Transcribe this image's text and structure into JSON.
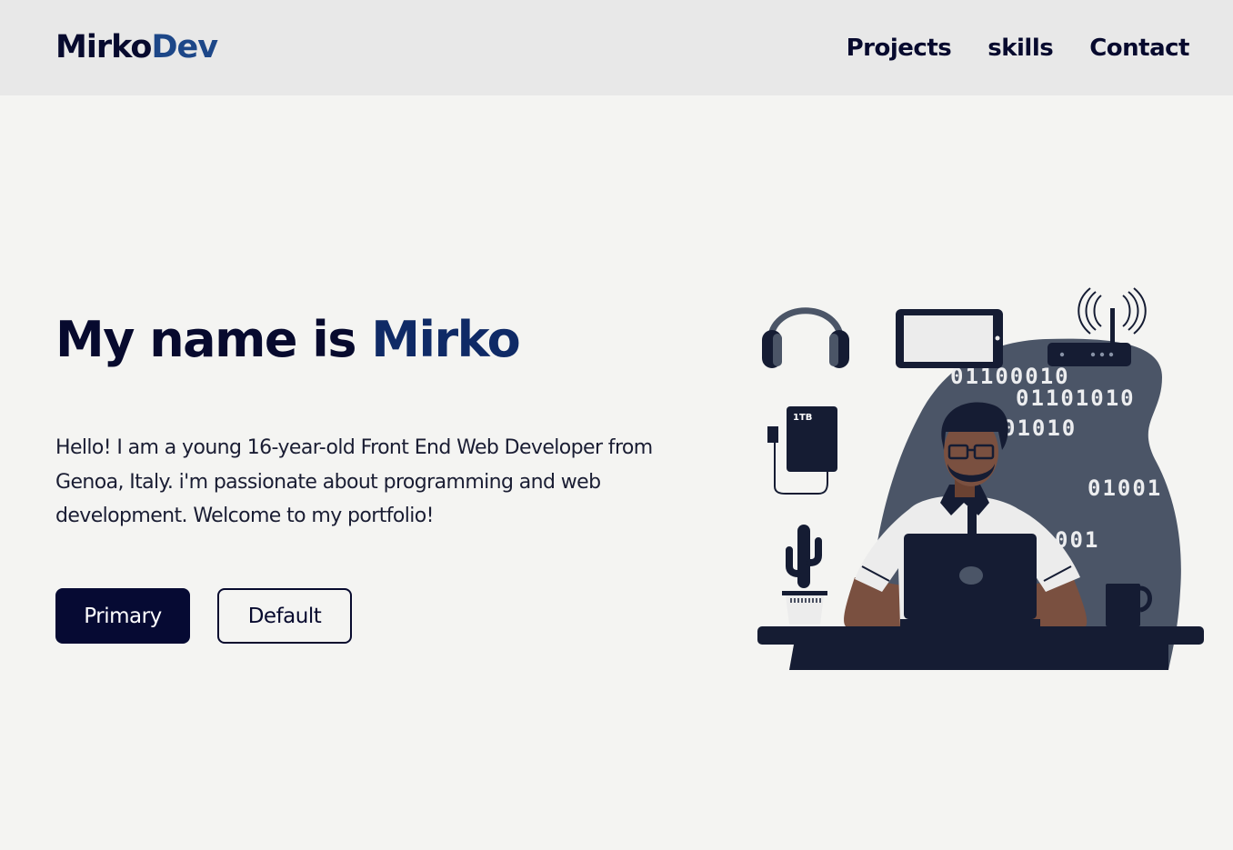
{
  "header": {
    "logo_primary": "Mirko",
    "logo_accent": "Dev",
    "nav": [
      "Projects",
      "skills",
      "Contact"
    ]
  },
  "hero": {
    "title_prefix": "My name is",
    "title_name": "Mirko",
    "intro": "Hello! I am a young 16-year-old Front End Web Developer from Genoa, Italy. i'm passionate about programming and web development. Welcome to my portfolio!",
    "primary_button": "Primary",
    "default_button": "Default"
  },
  "illustration": {
    "binary_lines": [
      "01100010",
      "01101010",
      "01010",
      "01001",
      "001"
    ],
    "drive_label": "1TB"
  },
  "colors": {
    "navy": "#070a2e",
    "accent_blue": "#1d4788",
    "header_bg": "#e8e8e8",
    "page_bg": "#f4f4f2",
    "slate": "#4b5567"
  }
}
